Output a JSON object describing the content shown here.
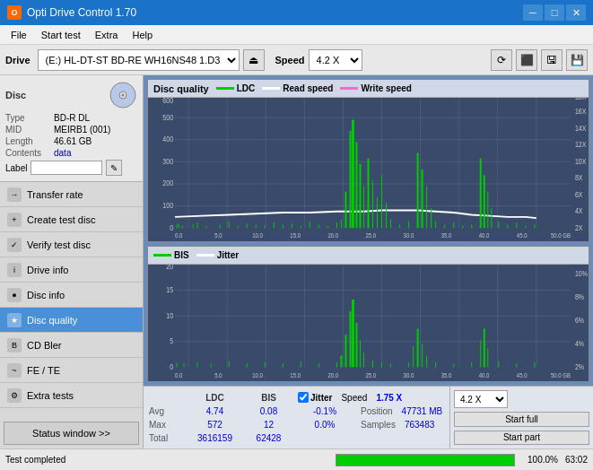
{
  "titlebar": {
    "title": "Opti Drive Control 1.70",
    "icon_label": "O",
    "min_btn": "─",
    "max_btn": "□",
    "close_btn": "✕"
  },
  "menubar": {
    "items": [
      "File",
      "Start test",
      "Extra",
      "Help"
    ]
  },
  "toolbar": {
    "drive_label": "Drive",
    "drive_value": "(E:)  HL-DT-ST BD-RE  WH16NS48 1.D3",
    "speed_label": "Speed",
    "speed_value": "4.2 X"
  },
  "disc": {
    "panel_title": "Disc",
    "type_label": "Type",
    "type_value": "BD-R DL",
    "mid_label": "MID",
    "mid_value": "MEIRB1 (001)",
    "length_label": "Length",
    "length_value": "46.61 GB",
    "contents_label": "Contents",
    "contents_value": "data",
    "label_label": "Label",
    "label_placeholder": ""
  },
  "nav": {
    "items": [
      {
        "id": "transfer-rate",
        "label": "Transfer rate",
        "icon": "→"
      },
      {
        "id": "create-test-disc",
        "label": "Create test disc",
        "icon": "+"
      },
      {
        "id": "verify-test-disc",
        "label": "Verify test disc",
        "icon": "✓"
      },
      {
        "id": "drive-info",
        "label": "Drive info",
        "icon": "i"
      },
      {
        "id": "disc-info",
        "label": "Disc info",
        "icon": "●"
      },
      {
        "id": "disc-quality",
        "label": "Disc quality",
        "icon": "★",
        "active": true
      },
      {
        "id": "cd-bler",
        "label": "CD Bler",
        "icon": "B"
      },
      {
        "id": "fe-te",
        "label": "FE / TE",
        "icon": "~"
      },
      {
        "id": "extra-tests",
        "label": "Extra tests",
        "icon": "⚙"
      }
    ]
  },
  "status_btn": "Status window >>",
  "chart1": {
    "title": "Disc quality",
    "legend": [
      {
        "label": "LDC",
        "color": "#00cc00"
      },
      {
        "label": "Read speed",
        "color": "#ffffff"
      },
      {
        "label": "Write speed",
        "color": "#ff66cc"
      }
    ],
    "y_max": 600,
    "y_ticks": [
      "600",
      "500",
      "400",
      "300",
      "200",
      "100",
      "0"
    ],
    "y_right_ticks": [
      "18X",
      "16X",
      "14X",
      "12X",
      "10X",
      "8X",
      "6X",
      "4X",
      "2X"
    ],
    "x_ticks": [
      "0.0",
      "5.0",
      "10.0",
      "15.0",
      "20.0",
      "25.0",
      "30.0",
      "35.0",
      "40.0",
      "45.0",
      "50.0 GB"
    ]
  },
  "chart2": {
    "legend": [
      {
        "label": "BIS",
        "color": "#00cc00"
      },
      {
        "label": "Jitter",
        "color": "#ffffff"
      }
    ],
    "y_max": 20,
    "y_ticks": [
      "20",
      "15",
      "10",
      "5",
      "0"
    ],
    "y_right_ticks": [
      "10%",
      "8%",
      "6%",
      "4%",
      "2%"
    ],
    "x_ticks": [
      "0.0",
      "5.0",
      "10.0",
      "15.0",
      "20.0",
      "25.0",
      "30.0",
      "35.0",
      "40.0",
      "45.0",
      "50.0 GB"
    ]
  },
  "data_table": {
    "col_ldc": "LDC",
    "col_bis": "BIS",
    "col_jitter_label": "Jitter",
    "col_speed": "Speed",
    "col_speed_val": "1.75 X",
    "col_speed_select": "4.2 X",
    "avg_label": "Avg",
    "avg_ldc": "4.74",
    "avg_bis": "0.08",
    "avg_jitter": "-0.1%",
    "max_label": "Max",
    "max_ldc": "572",
    "max_bis": "12",
    "max_jitter": "0.0%",
    "total_label": "Total",
    "total_ldc": "3616159",
    "total_bis": "62428",
    "position_label": "Position",
    "position_val": "47731 MB",
    "samples_label": "Samples",
    "samples_val": "763483",
    "start_full_btn": "Start full",
    "start_part_btn": "Start part",
    "jitter_checked": true
  },
  "statusbar": {
    "text": "Test completed",
    "progress": 100,
    "progress_label": "100.0%",
    "time": "63:02"
  }
}
